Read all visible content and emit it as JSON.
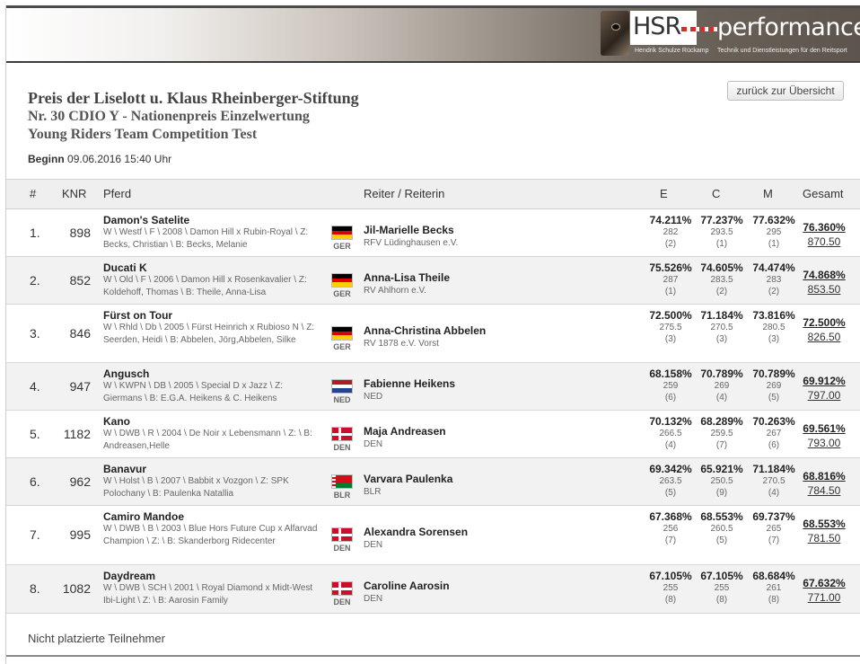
{
  "logo": {
    "brand_left": "HSR",
    "brand_right": "performance",
    "tagline_left": "Hendrik Schulze Rückamp",
    "tagline_right": "Technik und Dienstleistungen für den Reitsport"
  },
  "event": {
    "title": "Preis der Liselott u. Klaus Rheinberger-Stiftung",
    "subtitle1": "Nr. 30 CDIO Y - Nationenpreis Einzelwertung",
    "subtitle2": "Young Riders Team Competition Test",
    "begin_label": "Beginn",
    "begin_value": "09.06.2016 15:40 Uhr"
  },
  "back_button": "zurück zur Übersicht",
  "columns": {
    "rank": "#",
    "knr": "KNR",
    "horse": "Pferd",
    "rider": "Reiter / Reiterin",
    "e": "E",
    "c": "C",
    "m": "M",
    "total": "Gesamt"
  },
  "rows": [
    {
      "rank": "1.",
      "knr": "898",
      "horse": "Damon's Satelite",
      "horse_info": "W \\ Westf \\ F \\ 2008 \\ Damon Hill x Rubin-Royal \\ Z: Becks, Christian \\ B: Becks, Melanie",
      "nation": "GER",
      "rider": "Jil-Marielle Becks",
      "club": "RFV Lüdinghausen e.V.",
      "e": {
        "pct": "74.211%",
        "pts": "282",
        "rank": "(2)"
      },
      "c": {
        "pct": "77.237%",
        "pts": "293.5",
        "rank": "(1)"
      },
      "m": {
        "pct": "77.632%",
        "pts": "295",
        "rank": "(1)"
      },
      "total_pct": "76.360%",
      "total_pts": "870.50"
    },
    {
      "rank": "2.",
      "knr": "852",
      "horse": "Ducati K",
      "horse_info": "W \\ Old \\ F \\ 2006 \\ Damon Hill x Rosenkavalier \\ Z: Koldehoff, Thomas \\ B: Theile, Anna-Lisa",
      "nation": "GER",
      "rider": "Anna-Lisa Theile",
      "club": "RV Ahlhorn e.V.",
      "e": {
        "pct": "75.526%",
        "pts": "287",
        "rank": "(1)"
      },
      "c": {
        "pct": "74.605%",
        "pts": "283.5",
        "rank": "(2)"
      },
      "m": {
        "pct": "74.474%",
        "pts": "283",
        "rank": "(2)"
      },
      "total_pct": "74.868%",
      "total_pts": "853.50"
    },
    {
      "rank": "3.",
      "knr": "846",
      "horse": "Fürst on Tour",
      "horse_info": "W \\ Rhld \\ Db \\ 2005 \\ Fürst Heinrich x Rubioso N \\ Z: Seerden, Heidi \\ B: Abbelen, Jörg,Abbelen, Silke",
      "nation": "GER",
      "rider": "Anna-Christina Abbelen",
      "club": "RV 1878 e.V. Vorst",
      "e": {
        "pct": "72.500%",
        "pts": "275.5",
        "rank": "(3)"
      },
      "c": {
        "pct": "71.184%",
        "pts": "270.5",
        "rank": "(3)"
      },
      "m": {
        "pct": "73.816%",
        "pts": "280.5",
        "rank": "(3)"
      },
      "total_pct": "72.500%",
      "total_pts": "826.50"
    },
    {
      "rank": "4.",
      "knr": "947",
      "horse": "Angusch",
      "horse_info": "W \\ KWPN \\ DB \\ 2005 \\ Special D x Jazz \\ Z: Giermans \\ B: E.G.A. Heikens & C. Heikens",
      "nation": "NED",
      "rider": "Fabienne Heikens",
      "club": "NED",
      "e": {
        "pct": "68.158%",
        "pts": "259",
        "rank": "(6)"
      },
      "c": {
        "pct": "70.789%",
        "pts": "269",
        "rank": "(4)"
      },
      "m": {
        "pct": "70.789%",
        "pts": "269",
        "rank": "(5)"
      },
      "total_pct": "69.912%",
      "total_pts": "797.00"
    },
    {
      "rank": "5.",
      "knr": "1182",
      "horse": "Kano",
      "horse_info": "W \\ DWB \\ R \\ 2004 \\ De Noir x Lebensmann \\ Z: \\ B: Andreasen,Helle",
      "nation": "DEN",
      "rider": "Maja Andreasen",
      "club": "DEN",
      "e": {
        "pct": "70.132%",
        "pts": "266.5",
        "rank": "(4)"
      },
      "c": {
        "pct": "68.289%",
        "pts": "259.5",
        "rank": "(7)"
      },
      "m": {
        "pct": "70.263%",
        "pts": "267",
        "rank": "(6)"
      },
      "total_pct": "69.561%",
      "total_pts": "793.00"
    },
    {
      "rank": "6.",
      "knr": "962",
      "horse": "Banavur",
      "horse_info": "W \\ Holst \\ B \\ 2007 \\ Babbit x Vozgon \\ Z: SPK Polochany \\ B: Paulenka Natallia",
      "nation": "BLR",
      "rider": "Varvara Paulenka",
      "club": "BLR",
      "e": {
        "pct": "69.342%",
        "pts": "263.5",
        "rank": "(5)"
      },
      "c": {
        "pct": "65.921%",
        "pts": "250.5",
        "rank": "(9)"
      },
      "m": {
        "pct": "71.184%",
        "pts": "270.5",
        "rank": "(4)"
      },
      "total_pct": "68.816%",
      "total_pts": "784.50"
    },
    {
      "rank": "7.",
      "knr": "995",
      "horse": "Camiro Mandoe",
      "horse_info": "W \\ DWB \\ B \\ 2003 \\ Blue Hors Future Cup x Alfarvad Champion \\ Z: \\ B: Skanderborg Ridecenter",
      "nation": "DEN",
      "rider": "Alexandra Sorensen",
      "club": "DEN",
      "e": {
        "pct": "67.368%",
        "pts": "256",
        "rank": "(7)"
      },
      "c": {
        "pct": "68.553%",
        "pts": "260.5",
        "rank": "(5)"
      },
      "m": {
        "pct": "69.737%",
        "pts": "265",
        "rank": "(7)"
      },
      "total_pct": "68.553%",
      "total_pts": "781.50"
    },
    {
      "rank": "8.",
      "knr": "1082",
      "horse": "Daydream",
      "horse_info": "W \\ DWB \\ SCH \\ 2001 \\ Royal Diamond x Midt-West Ibi-Light \\ Z: \\ B: Aarosin Family",
      "nation": "DEN",
      "rider": "Caroline Aarosin",
      "club": "DEN",
      "e": {
        "pct": "67.105%",
        "pts": "255",
        "rank": "(8)"
      },
      "c": {
        "pct": "67.105%",
        "pts": "255",
        "rank": "(8)"
      },
      "m": {
        "pct": "68.684%",
        "pts": "261",
        "rank": "(8)"
      },
      "total_pct": "67.632%",
      "total_pts": "771.00"
    }
  ],
  "unplaced_label": "Nicht platzierte Teilnehmer",
  "flags": {
    "GER": [
      "#000000",
      "#dd0000",
      "#ffce00"
    ],
    "NED": [
      "#ae1c28",
      "#ffffff",
      "#21468b"
    ],
    "DEN": "dk",
    "BLR": "by"
  }
}
